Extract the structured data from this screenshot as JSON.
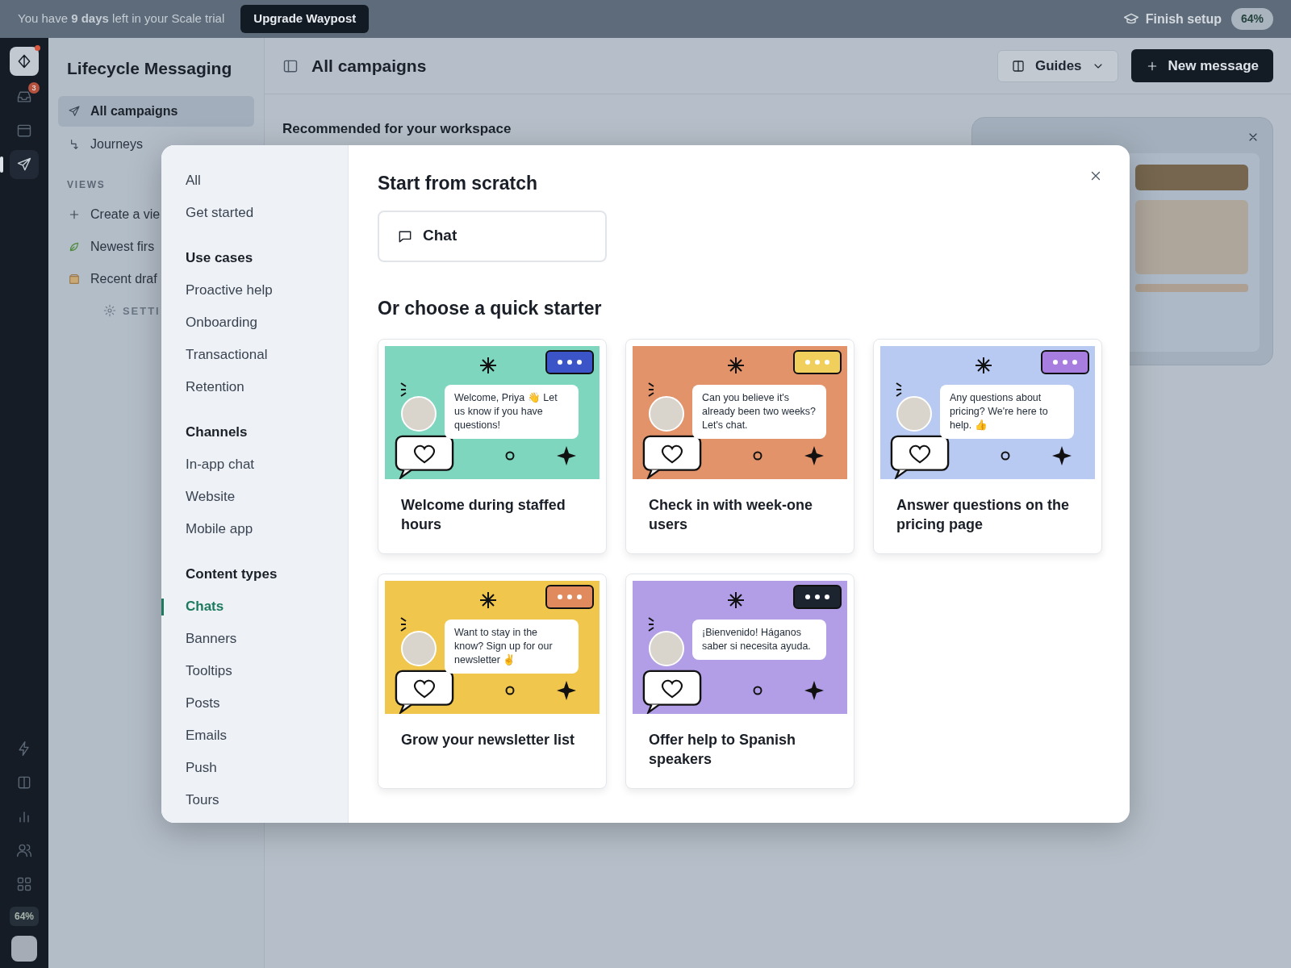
{
  "banner": {
    "text": "You have **9 days** left in your Scale trial",
    "upgrade": "Upgrade Waypost",
    "setup": "Finish setup",
    "setup_percent": "64%"
  },
  "rail": {
    "inbox_badge": "3",
    "percent": "64%"
  },
  "sidebar": {
    "title": "Lifecycle Messaging",
    "items": [
      {
        "label": "All campaigns",
        "kind": "send",
        "selected": true
      },
      {
        "label": "Journeys",
        "kind": "journey",
        "selected": false
      }
    ],
    "views_heading": "VIEWS",
    "views": [
      {
        "label": "Create a vie",
        "kind": "add"
      },
      {
        "label": "Newest firs",
        "kind": "leaf"
      },
      {
        "label": "Recent draf",
        "kind": "box"
      }
    ],
    "settings": "SETTI"
  },
  "header": {
    "title": "All campaigns",
    "guides": "Guides",
    "new_message": "New message"
  },
  "recommended": "Recommended for your workspace",
  "modal": {
    "nav": [
      {
        "label": "All",
        "kind": "item",
        "selected": false
      },
      {
        "label": "Get started",
        "kind": "item",
        "selected": false
      },
      {
        "label": "Use cases",
        "kind": "heading"
      },
      {
        "label": "Proactive help",
        "kind": "item",
        "selected": false
      },
      {
        "label": "Onboarding",
        "kind": "item",
        "selected": false
      },
      {
        "label": "Transactional",
        "kind": "item",
        "selected": false
      },
      {
        "label": "Retention",
        "kind": "item",
        "selected": false
      },
      {
        "label": "Channels",
        "kind": "heading"
      },
      {
        "label": "In-app chat",
        "kind": "item",
        "selected": false
      },
      {
        "label": "Website",
        "kind": "item",
        "selected": false
      },
      {
        "label": "Mobile app",
        "kind": "item",
        "selected": false
      },
      {
        "label": "Content types",
        "kind": "heading"
      },
      {
        "label": "Chats",
        "kind": "item",
        "selected": true
      },
      {
        "label": "Banners",
        "kind": "item",
        "selected": false
      },
      {
        "label": "Tooltips",
        "kind": "item",
        "selected": false
      },
      {
        "label": "Posts",
        "kind": "item",
        "selected": false
      },
      {
        "label": "Emails",
        "kind": "item",
        "selected": false
      },
      {
        "label": "Push",
        "kind": "item",
        "selected": false
      },
      {
        "label": "Tours",
        "kind": "item",
        "selected": false
      }
    ],
    "scratch_heading": "Start from scratch",
    "scratch_button": "Chat",
    "starter_heading": "Or choose a quick starter",
    "starters": [
      {
        "title": "Welcome during staffed hours",
        "bubble": "Welcome, Priya 👋 Let us know if you have questions!",
        "color": "#7fd6bf",
        "typing_bubble": {
          "color": "#3b55c9"
        }
      },
      {
        "title": "Check in with week-one users",
        "bubble": "Can you believe it's already been two weeks? Let's chat.",
        "color": "#e3936a",
        "typing_bubble": {
          "color": "#f0cf5c"
        }
      },
      {
        "title": "Answer questions on the pricing page",
        "bubble": "Any questions about pricing? We're here to help. 👍",
        "color": "#b8caf2",
        "typing_bubble": {
          "color": "#a77de0"
        }
      },
      {
        "title": "Grow your newsletter list",
        "bubble": "Want to stay in the know? Sign up for our newsletter ✌️",
        "color": "#f0c64c",
        "typing_bubble": {
          "color": "#e08a5e"
        }
      },
      {
        "title": "Offer help to Spanish speakers",
        "bubble": "¡Bienvenido! Háganos saber si necesita ayuda.",
        "color": "#b19ee6",
        "typing_bubble": {
          "color": "#1c2430"
        }
      }
    ]
  }
}
